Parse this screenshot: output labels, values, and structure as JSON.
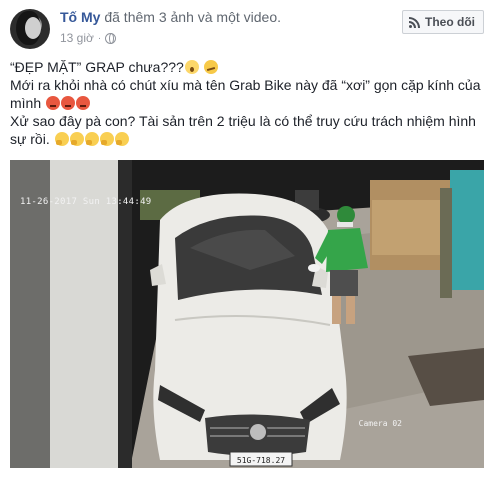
{
  "post": {
    "author": "Tố My",
    "action": "đã thêm 3 ảnh và một video.",
    "time": "13 giờ",
    "follow_label": "Theo dõi",
    "lines": {
      "line1": "“ĐẸP MẶT” GRAP chưa???",
      "line2": "Mới ra khỏi nhà có chút xíu mà tên Grab Bike này đã “xơi” gọn cặp kính của",
      "line3": "mình",
      "line4": "Xử sao đây pà con? Tài sản trên 2 triệu là có thể truy cứu trách nhiệm hình",
      "line5": "sự rồi."
    }
  },
  "media": {
    "timestamp": "11-26-2017 Sun 13:44:49",
    "camera_label": "Camera 02",
    "plate": "51G-718.27"
  },
  "icons": {
    "follow": "rss-icon",
    "audience": "globe-icon"
  },
  "colors": {
    "name_link": "#365899",
    "muted": "#90949c",
    "text": "#1d2129"
  }
}
